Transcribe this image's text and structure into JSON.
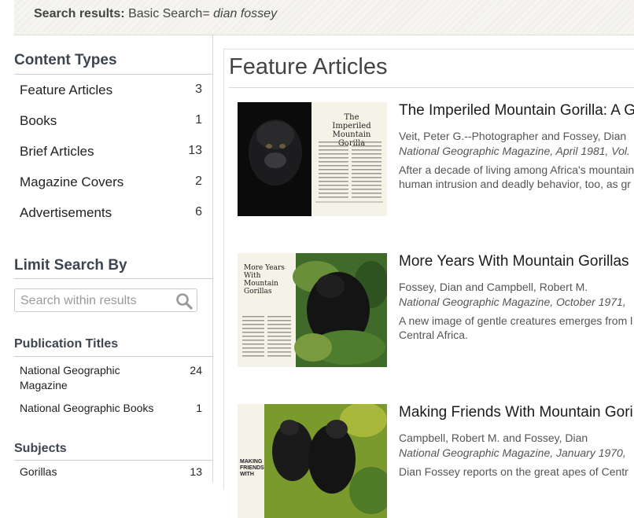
{
  "header": {
    "label": "Search results:",
    "query_prefix": "Basic Search=",
    "query": "dian fossey"
  },
  "sidebar": {
    "content_types_heading": "Content Types",
    "content_types": [
      {
        "label": "Feature Articles",
        "count": "3"
      },
      {
        "label": "Books",
        "count": "1"
      },
      {
        "label": "Brief Articles",
        "count": "13"
      },
      {
        "label": "Magazine Covers",
        "count": "2"
      },
      {
        "label": "Advertisements",
        "count": "6"
      }
    ],
    "limit_heading": "Limit Search By",
    "search_placeholder": "Search within results",
    "pub_heading": "Publication Titles",
    "publications": [
      {
        "label": "National Geographic Magazine",
        "count": "24"
      },
      {
        "label": "National Geographic Books",
        "count": "1"
      }
    ],
    "subjects_heading": "Subjects",
    "subjects": [
      {
        "label": "Gorillas",
        "count": "13"
      }
    ]
  },
  "main": {
    "title": "Feature Articles",
    "articles": [
      {
        "title": "The Imperiled Mountain Gorilla: A G",
        "authors": "Veit, Peter G.--Photographer and Fossey, Dian",
        "source": "National Geographic Magazine, April 1981, Vol.",
        "desc1": "After a decade of living among Africa's mountain",
        "desc2": "human intrusion and deadly behavior, too, as gr",
        "thumb_page_title": "The Imperiled Mountain Gorilla"
      },
      {
        "title": "More Years With Mountain Gorillas",
        "authors": "Fossey, Dian and Campbell, Robert M.",
        "source": "National Geographic Magazine, October 1971,",
        "desc1": "A new image of gentle creatures emerges from l",
        "desc2": "Central Africa.",
        "thumb_page_title": "More Years With Mountain Gorillas"
      },
      {
        "title": "Making Friends With Mountain Goril",
        "authors": "Campbell, Robert M. and Fossey, Dian",
        "source": "National Geographic Magazine, January 1970,",
        "desc1": "Dian Fossey reports on the great apes of Centr",
        "desc2": "",
        "thumb_page_title": "MAKING FRIENDS WITH"
      }
    ]
  },
  "colors": {
    "heading": "#3d4650",
    "accent_rule": "#cfcfcf",
    "header_bg": "#f5f4f0"
  }
}
